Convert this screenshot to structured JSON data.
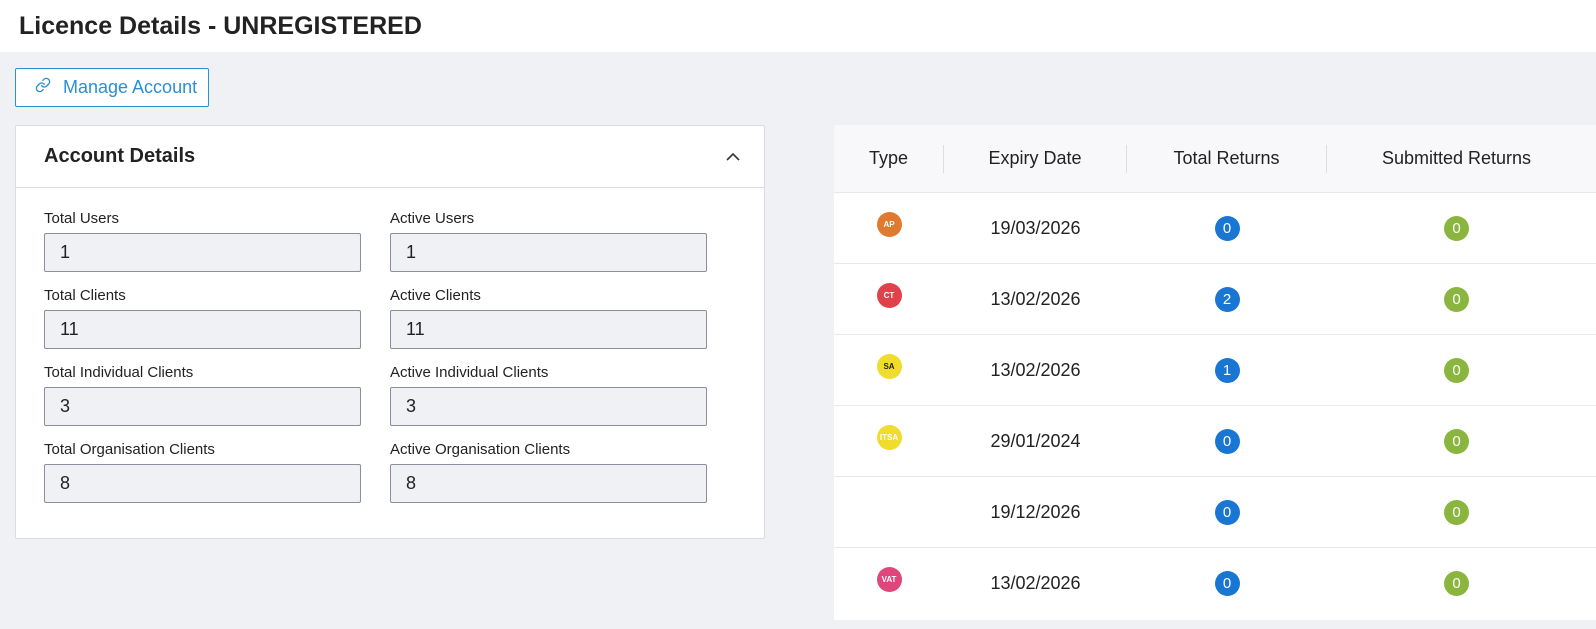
{
  "header": {
    "title": "Licence Details - UNREGISTERED"
  },
  "manage_button": {
    "label": "Manage Account"
  },
  "account_details": {
    "title": "Account Details",
    "fields": [
      {
        "label": "Total Users",
        "value": "1"
      },
      {
        "label": "Active Users",
        "value": "1"
      },
      {
        "label": "Total Clients",
        "value": "11"
      },
      {
        "label": "Active Clients",
        "value": "11"
      },
      {
        "label": "Total Individual Clients",
        "value": "3"
      },
      {
        "label": "Active Individual Clients",
        "value": "3"
      },
      {
        "label": "Total Organisation Clients",
        "value": "8"
      },
      {
        "label": "Active Organisation Clients",
        "value": "8"
      }
    ]
  },
  "licence_table": {
    "headers": {
      "type": "Type",
      "expiry": "Expiry Date",
      "total_returns": "Total Returns",
      "submitted_returns": "Submitted Returns"
    },
    "rows": [
      {
        "type": "AP",
        "type_color": "#e07a2e",
        "type_text_color": "#ffffff",
        "expiry": "19/03/2026",
        "total_returns": "0",
        "submitted_returns": "0"
      },
      {
        "type": "CT",
        "type_color": "#e2404a",
        "type_text_color": "#ffffff",
        "expiry": "13/02/2026",
        "total_returns": "2",
        "submitted_returns": "0"
      },
      {
        "type": "SA",
        "type_color": "#f0dc2c",
        "type_text_color": "#222222",
        "expiry": "13/02/2026",
        "total_returns": "1",
        "submitted_returns": "0"
      },
      {
        "type": "ITSA",
        "type_color": "#f0dc2c",
        "type_text_color": "#ffffff",
        "expiry": "29/01/2024",
        "total_returns": "0",
        "submitted_returns": "0"
      },
      {
        "type": "",
        "type_color": "",
        "type_text_color": "#ffffff",
        "expiry": "19/12/2026",
        "total_returns": "0",
        "submitted_returns": "0"
      },
      {
        "type": "VAT",
        "type_color": "#e0457c",
        "type_text_color": "#ffffff",
        "expiry": "13/02/2026",
        "total_returns": "0",
        "submitted_returns": "0"
      }
    ]
  },
  "colors": {
    "accent": "#2b8fd6",
    "total_badge": "#1976d2",
    "submitted_badge": "#8ab53f"
  }
}
